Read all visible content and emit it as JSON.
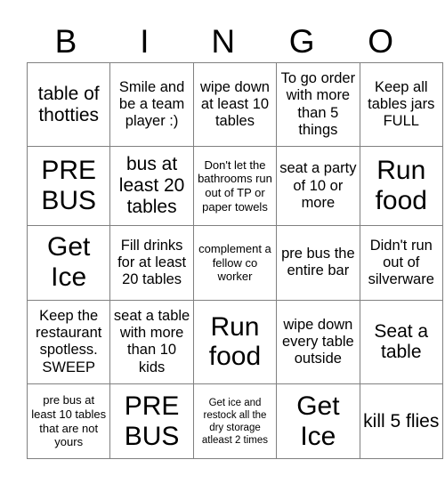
{
  "header": {
    "letters": [
      "B",
      "I",
      "N",
      "G",
      "O"
    ]
  },
  "grid": {
    "rows": [
      [
        {
          "text": "table of thotties",
          "size": "sz-lg"
        },
        {
          "text": "Smile and be a team player :)",
          "size": "sz-md"
        },
        {
          "text": "wipe down at least 10 tables",
          "size": "sz-md"
        },
        {
          "text": "To go order with more than 5 things",
          "size": "sz-md"
        },
        {
          "text": "Keep all tables jars FULL",
          "size": "sz-md"
        }
      ],
      [
        {
          "text": "PRE BUS",
          "size": "sz-xl"
        },
        {
          "text": "bus at least 20 tables",
          "size": "sz-lg"
        },
        {
          "text": "Don't let the bathrooms run out of TP or paper towels",
          "size": "sz-sm"
        },
        {
          "text": "seat a party of 10 or more",
          "size": "sz-md"
        },
        {
          "text": "Run food",
          "size": "sz-xl"
        }
      ],
      [
        {
          "text": "Get Ice",
          "size": "sz-xl"
        },
        {
          "text": "Fill drinks for at least 20 tables",
          "size": "sz-md"
        },
        {
          "text": "complement a fellow co worker",
          "size": "sz-sm"
        },
        {
          "text": "pre bus the entire bar",
          "size": "sz-md"
        },
        {
          "text": "Didn't run out of silverware",
          "size": "sz-md"
        }
      ],
      [
        {
          "text": "Keep the restaurant spotless. SWEEP",
          "size": "sz-md"
        },
        {
          "text": "seat a table with more than 10 kids",
          "size": "sz-md"
        },
        {
          "text": "Run food",
          "size": "sz-xl"
        },
        {
          "text": "wipe down every table outside",
          "size": "sz-md"
        },
        {
          "text": "Seat a table",
          "size": "sz-lg"
        }
      ],
      [
        {
          "text": "pre bus at least 10 tables that are not yours",
          "size": "sz-sm"
        },
        {
          "text": "PRE BUS",
          "size": "sz-xl"
        },
        {
          "text": "Get ice and restock all the dry storage atleast 2 times",
          "size": "sz-xs"
        },
        {
          "text": "Get Ice",
          "size": "sz-xl"
        },
        {
          "text": "kill 5 flies",
          "size": "sz-lg"
        }
      ]
    ]
  },
  "colors": {
    "background": "#ffffff",
    "text": "#000000",
    "border": "#808080"
  }
}
